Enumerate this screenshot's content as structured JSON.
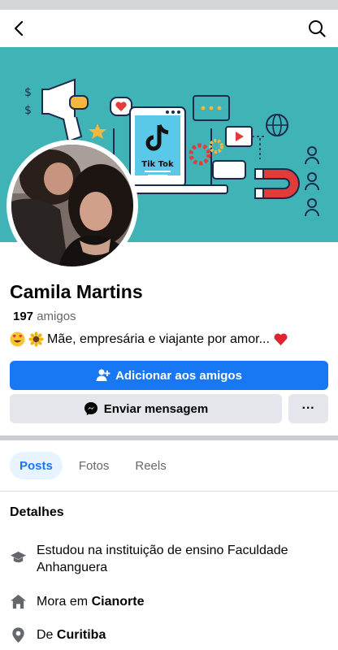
{
  "profile": {
    "name": "Camila Martins",
    "friends_count": "197",
    "friends_label": "amigos",
    "bio": "Mãe, empresária e viajante por amor...",
    "bio_emojis": [
      "heart-eyes-emoji",
      "sunflower-emoji",
      "red-heart-emoji"
    ]
  },
  "cover": {
    "app_label": "Tik Tok",
    "accent": "#3fb3b5"
  },
  "actions": {
    "add_friend": "Adicionar aos amigos",
    "message": "Enviar mensagem",
    "more": "···"
  },
  "tabs": [
    {
      "label": "Posts",
      "active": true
    },
    {
      "label": "Fotos",
      "active": false
    },
    {
      "label": "Reels",
      "active": false
    }
  ],
  "details": {
    "title": "Detalhes",
    "education": "Estudou na instituição de ensino Faculdade Anhanguera",
    "lives_prefix": "Mora em",
    "lives_city": "Cianorte",
    "from_prefix": "De",
    "from_city": "Curitiba"
  },
  "colors": {
    "primary": "#1877f2",
    "secondary_button": "#e4e6eb",
    "tab_active_bg": "#e7f3ff"
  }
}
